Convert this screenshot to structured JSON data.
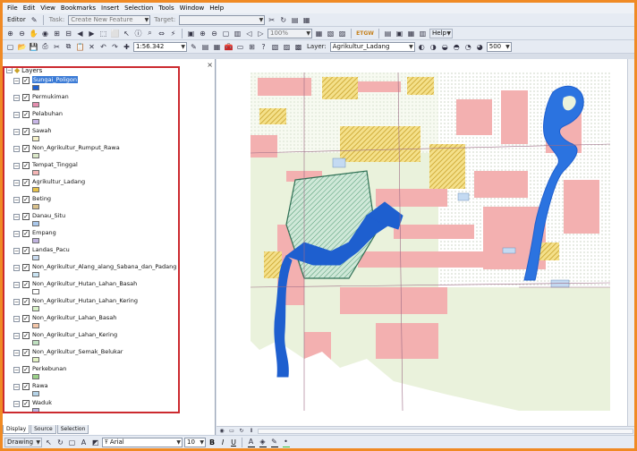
{
  "menu": [
    "File",
    "Edit",
    "View",
    "Bookmarks",
    "Insert",
    "Selection",
    "Tools",
    "Window",
    "Help"
  ],
  "editor_toolbar": {
    "editor_label": "Editor",
    "task_label": "Task:",
    "task_value": "Create New Feature",
    "target_label": "Target:",
    "target_value": ""
  },
  "tools_toolbar": {
    "zoom_value": "100%",
    "help_label": "Help"
  },
  "standard_toolbar": {
    "scale_value": "1:56.342",
    "layer_label": "Layer:",
    "layer_value": "Agrikultur_Ladang",
    "size_value": "500"
  },
  "toc": {
    "root_label": "Layers",
    "layers": [
      {
        "name": "Sungai_Poligon",
        "color": "#1e5fcf",
        "selected": true
      },
      {
        "name": "Permukiman",
        "color": "#e58fb0"
      },
      {
        "name": "Pelabuhan",
        "color": "#c8b6e6"
      },
      {
        "name": "Sawah",
        "color": "#f4f0c9"
      },
      {
        "name": "Non_Agrikultur_Rumput_Rawa",
        "color": "#dbe8c9"
      },
      {
        "name": "Tempat_Tinggal",
        "color": "#f4b5b5"
      },
      {
        "name": "Agrikultur_Ladang",
        "color": "#e6c24a"
      },
      {
        "name": "Beting",
        "color": "#d9c18d"
      },
      {
        "name": "Danau_Situ",
        "color": "#aac8ec"
      },
      {
        "name": "Empang",
        "color": "#c0b3df"
      },
      {
        "name": "Landas_Pacu",
        "color": "#c9dbf0"
      },
      {
        "name": "Non_Agrikultur_Alang_alang_Sabana_dan_Padang",
        "color": "#c9e3f2"
      },
      {
        "name": "Non_Agrikultur_Hutan_Lahan_Basah",
        "color": "#ffffff"
      },
      {
        "name": "Non_Agrikultur_Hutan_Lahan_Kering",
        "color": "#d8f0c8"
      },
      {
        "name": "Non_Agrikultur_Lahan_Basah",
        "color": "#f3c6a8"
      },
      {
        "name": "Non_Agrikultur_Lahan_Kering",
        "color": "#bfe0c0"
      },
      {
        "name": "Non_Agrikultur_Semak_Belukar",
        "color": "#e3f2c4"
      },
      {
        "name": "Perkebunan",
        "color": "#9bd18a"
      },
      {
        "name": "Rawa",
        "color": "#b5d3e8"
      },
      {
        "name": "Waduk",
        "color": "#b8b3e0"
      }
    ],
    "tabs": [
      "Display",
      "Source",
      "Selection"
    ]
  },
  "drawing_toolbar": {
    "drawing_label": "Drawing",
    "font_value": "Arial",
    "size_value": "10",
    "bold": "B",
    "italic": "I",
    "underline": "U"
  }
}
